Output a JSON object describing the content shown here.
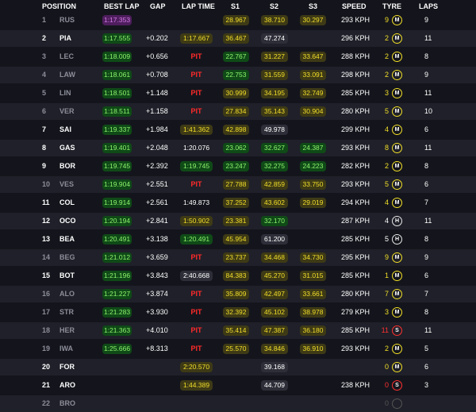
{
  "header": {
    "position": "POSITION",
    "best_lap": "BEST LAP",
    "gap": "GAP",
    "lap_time": "LAP TIME",
    "s1": "S1",
    "s2": "S2",
    "s3": "S3",
    "speed": "SPEED",
    "tyre": "TYRE",
    "laps": "LAPS"
  },
  "colors": {
    "personal_best": "#8ef56d",
    "yellow": "#f2df28",
    "overall_best": "#d47ae6",
    "pit": "#ff2a2a"
  },
  "rows": [
    {
      "pos": "1",
      "code": "RUS",
      "dim": true,
      "best": "1:17.353",
      "best_c": "purple",
      "gap": "",
      "lt": "",
      "lt_c": "none",
      "pit": "",
      "s1": "28.967",
      "s1_c": "yellow",
      "s2": "38.710",
      "s2_c": "yellow",
      "s3": "30.297",
      "s3_c": "yellow",
      "speed": "293 KPH",
      "age": "9",
      "age_c": "yellow",
      "tyre": "M",
      "laps": "9"
    },
    {
      "pos": "2",
      "code": "PIA",
      "dim": false,
      "best": "1:17.555",
      "best_c": "green",
      "gap": "+0.202",
      "lt": "1:17.667",
      "lt_c": "yellow",
      "pit": "",
      "s1": "36.467",
      "s1_c": "yellow",
      "s2": "47.274",
      "s2_c": "grey",
      "s3": "",
      "s3_c": "none",
      "speed": "296 KPH",
      "age": "2",
      "age_c": "yellow",
      "tyre": "M",
      "laps": "11"
    },
    {
      "pos": "3",
      "code": "LEC",
      "dim": true,
      "best": "1:18.009",
      "best_c": "green",
      "gap": "+0.656",
      "lt": "",
      "lt_c": "none",
      "pit": "PIT",
      "s1": "22.767",
      "s1_c": "green",
      "s2": "31.227",
      "s2_c": "yellow",
      "s3": "33.647",
      "s3_c": "yellow",
      "speed": "288 KPH",
      "age": "2",
      "age_c": "yellow",
      "tyre": "M",
      "laps": "8"
    },
    {
      "pos": "4",
      "code": "LAW",
      "dim": true,
      "best": "1:18.061",
      "best_c": "green",
      "gap": "+0.708",
      "lt": "",
      "lt_c": "none",
      "pit": "PIT",
      "s1": "22.753",
      "s1_c": "green",
      "s2": "31.559",
      "s2_c": "yellow",
      "s3": "33.091",
      "s3_c": "yellow",
      "speed": "298 KPH",
      "age": "2",
      "age_c": "yellow",
      "tyre": "M",
      "laps": "9"
    },
    {
      "pos": "5",
      "code": "LIN",
      "dim": true,
      "best": "1:18.501",
      "best_c": "green",
      "gap": "+1.148",
      "lt": "",
      "lt_c": "none",
      "pit": "PIT",
      "s1": "30.999",
      "s1_c": "yellow",
      "s2": "34.195",
      "s2_c": "yellow",
      "s3": "32.749",
      "s3_c": "yellow",
      "speed": "285 KPH",
      "age": "3",
      "age_c": "yellow",
      "tyre": "M",
      "laps": "11"
    },
    {
      "pos": "6",
      "code": "VER",
      "dim": true,
      "best": "1:18.511",
      "best_c": "green",
      "gap": "+1.158",
      "lt": "",
      "lt_c": "none",
      "pit": "PIT",
      "s1": "27.834",
      "s1_c": "yellow",
      "s2": "35.143",
      "s2_c": "yellow",
      "s3": "30.904",
      "s3_c": "yellow",
      "speed": "280 KPH",
      "age": "5",
      "age_c": "yellow",
      "tyre": "M",
      "laps": "10"
    },
    {
      "pos": "7",
      "code": "SAI",
      "dim": false,
      "best": "1:19.337",
      "best_c": "green",
      "gap": "+1.984",
      "lt": "1:41.362",
      "lt_c": "yellow",
      "pit": "",
      "s1": "42.898",
      "s1_c": "yellow",
      "s2": "49.978",
      "s2_c": "grey",
      "s3": "",
      "s3_c": "none",
      "speed": "299 KPH",
      "age": "4",
      "age_c": "yellow",
      "tyre": "M",
      "laps": "6"
    },
    {
      "pos": "8",
      "code": "GAS",
      "dim": false,
      "best": "1:19.401",
      "best_c": "green",
      "gap": "+2.048",
      "lt": "1:20.076",
      "lt_c": "none",
      "pit": "",
      "s1": "23.062",
      "s1_c": "green",
      "s2": "32.627",
      "s2_c": "green",
      "s3": "24.387",
      "s3_c": "green",
      "speed": "293 KPH",
      "age": "8",
      "age_c": "yellow",
      "tyre": "M",
      "laps": "11"
    },
    {
      "pos": "9",
      "code": "BOR",
      "dim": false,
      "best": "1:19.745",
      "best_c": "green",
      "gap": "+2.392",
      "lt": "1:19.745",
      "lt_c": "green",
      "pit": "",
      "s1": "23.247",
      "s1_c": "green",
      "s2": "32.275",
      "s2_c": "green",
      "s3": "24.223",
      "s3_c": "green",
      "speed": "282 KPH",
      "age": "2",
      "age_c": "yellow",
      "tyre": "M",
      "laps": "8"
    },
    {
      "pos": "10",
      "code": "VES",
      "dim": true,
      "best": "1:19.904",
      "best_c": "green",
      "gap": "+2.551",
      "lt": "",
      "lt_c": "none",
      "pit": "PIT",
      "s1": "27.788",
      "s1_c": "yellow",
      "s2": "42.859",
      "s2_c": "yellow",
      "s3": "33.750",
      "s3_c": "yellow",
      "speed": "293 KPH",
      "age": "5",
      "age_c": "yellow",
      "tyre": "M",
      "laps": "6"
    },
    {
      "pos": "11",
      "code": "COL",
      "dim": false,
      "best": "1:19.914",
      "best_c": "green",
      "gap": "+2.561",
      "lt": "1:49.873",
      "lt_c": "none",
      "pit": "",
      "s1": "37.252",
      "s1_c": "yellow",
      "s2": "43.602",
      "s2_c": "yellow",
      "s3": "29.019",
      "s3_c": "yellow",
      "speed": "294 KPH",
      "age": "4",
      "age_c": "yellow",
      "tyre": "M",
      "laps": "7"
    },
    {
      "pos": "12",
      "code": "OCO",
      "dim": false,
      "best": "1:20.194",
      "best_c": "green",
      "gap": "+2.841",
      "lt": "1:50.902",
      "lt_c": "yellow",
      "pit": "",
      "s1": "23.381",
      "s1_c": "yellow",
      "s2": "32.170",
      "s2_c": "green",
      "s3": "",
      "s3_c": "none",
      "speed": "287 KPH",
      "age": "4",
      "age_c": "none",
      "tyre": "H",
      "laps": "11"
    },
    {
      "pos": "13",
      "code": "BEA",
      "dim": false,
      "best": "1:20.491",
      "best_c": "green",
      "gap": "+3.138",
      "lt": "1:20.491",
      "lt_c": "green",
      "pit": "",
      "s1": "45.954",
      "s1_c": "yellow",
      "s2": "61.200",
      "s2_c": "grey",
      "s3": "",
      "s3_c": "none",
      "speed": "285 KPH",
      "age": "5",
      "age_c": "none",
      "tyre": "H",
      "laps": "8"
    },
    {
      "pos": "14",
      "code": "BEG",
      "dim": true,
      "best": "1:21.012",
      "best_c": "green",
      "gap": "+3.659",
      "lt": "",
      "lt_c": "none",
      "pit": "PIT",
      "s1": "23.737",
      "s1_c": "yellow",
      "s2": "34.468",
      "s2_c": "yellow",
      "s3": "34.730",
      "s3_c": "yellow",
      "speed": "295 KPH",
      "age": "9",
      "age_c": "yellow",
      "tyre": "M",
      "laps": "9"
    },
    {
      "pos": "15",
      "code": "BOT",
      "dim": false,
      "best": "1:21.196",
      "best_c": "green",
      "gap": "+3.843",
      "lt": "2:40.668",
      "lt_c": "grey",
      "pit": "",
      "s1": "84.383",
      "s1_c": "yellow",
      "s2": "45.270",
      "s2_c": "yellow",
      "s3": "31.015",
      "s3_c": "yellow",
      "speed": "285 KPH",
      "age": "1",
      "age_c": "yellow",
      "tyre": "M",
      "laps": "6"
    },
    {
      "pos": "16",
      "code": "ALO",
      "dim": true,
      "best": "1:21.227",
      "best_c": "green",
      "gap": "+3.874",
      "lt": "",
      "lt_c": "none",
      "pit": "PIT",
      "s1": "35.809",
      "s1_c": "yellow",
      "s2": "42.497",
      "s2_c": "yellow",
      "s3": "33.661",
      "s3_c": "yellow",
      "speed": "280 KPH",
      "age": "7",
      "age_c": "yellow",
      "tyre": "M",
      "laps": "7"
    },
    {
      "pos": "17",
      "code": "STR",
      "dim": true,
      "best": "1:21.283",
      "best_c": "green",
      "gap": "+3.930",
      "lt": "",
      "lt_c": "none",
      "pit": "PIT",
      "s1": "32.392",
      "s1_c": "yellow",
      "s2": "45.102",
      "s2_c": "yellow",
      "s3": "38.978",
      "s3_c": "yellow",
      "speed": "279 KPH",
      "age": "3",
      "age_c": "yellow",
      "tyre": "M",
      "laps": "8"
    },
    {
      "pos": "18",
      "code": "HER",
      "dim": true,
      "best": "1:21.363",
      "best_c": "green",
      "gap": "+4.010",
      "lt": "",
      "lt_c": "none",
      "pit": "PIT",
      "s1": "35.414",
      "s1_c": "yellow",
      "s2": "47.387",
      "s2_c": "yellow",
      "s3": "36.180",
      "s3_c": "yellow",
      "speed": "285 KPH",
      "age": "11",
      "age_c": "red",
      "tyre": "S",
      "laps": "11"
    },
    {
      "pos": "19",
      "code": "IWA",
      "dim": true,
      "best": "1:25.666",
      "best_c": "green",
      "gap": "+8.313",
      "lt": "",
      "lt_c": "none",
      "pit": "PIT",
      "s1": "25.570",
      "s1_c": "yellow",
      "s2": "34.846",
      "s2_c": "yellow",
      "s3": "36.910",
      "s3_c": "yellow",
      "speed": "293 KPH",
      "age": "2",
      "age_c": "yellow",
      "tyre": "M",
      "laps": "5"
    },
    {
      "pos": "20",
      "code": "FOR",
      "dim": false,
      "best": "",
      "best_c": "none",
      "gap": "",
      "lt": "2:20.570",
      "lt_c": "yellow",
      "pit": "",
      "s1": "",
      "s1_c": "none",
      "s2": "39.168",
      "s2_c": "grey",
      "s3": "",
      "s3_c": "none",
      "speed": "",
      "age": "0",
      "age_c": "yellow",
      "tyre": "M",
      "laps": "6"
    },
    {
      "pos": "21",
      "code": "ARO",
      "dim": false,
      "best": "",
      "best_c": "none",
      "gap": "",
      "lt": "1:44.389",
      "lt_c": "yellow",
      "pit": "",
      "s1": "",
      "s1_c": "none",
      "s2": "44.709",
      "s2_c": "grey",
      "s3": "",
      "s3_c": "none",
      "speed": "238 KPH",
      "age": "0",
      "age_c": "red",
      "tyre": "S",
      "laps": "3"
    },
    {
      "pos": "22",
      "code": "BRO",
      "dim": true,
      "best": "",
      "best_c": "none",
      "gap": "",
      "lt": "",
      "lt_c": "none",
      "pit": "",
      "s1": "",
      "s1_c": "none",
      "s2": "",
      "s2_c": "none",
      "s3": "",
      "s3_c": "none",
      "speed": "",
      "age": "0",
      "age_c": "dim",
      "tyre": "",
      "laps": ""
    }
  ]
}
